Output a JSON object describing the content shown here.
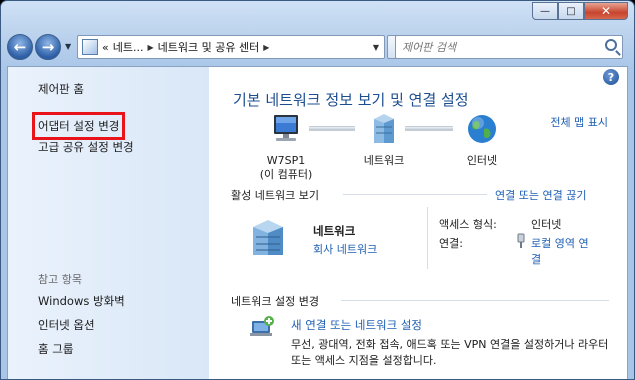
{
  "window": {
    "controls": {
      "minimize": "—",
      "maximize": "□",
      "close": "✕"
    }
  },
  "navbar": {
    "back_icon": "←",
    "forward_icon": "→",
    "history_dropdown": "▼",
    "address": {
      "overflow": "«",
      "segment1": "네트...",
      "separator": "▶",
      "segment2": "네트워크 및 공유 센터",
      "separator2": "▶",
      "dropdown": "▼"
    },
    "refresh_icon": "↻",
    "search_placeholder": "제어판 검색"
  },
  "sidebar": {
    "home": "제어판 홈",
    "change_adapter": "어댑터 설정 변경",
    "advanced_sharing": "고급 공유 설정 변경",
    "see_also_heading": "참고 항목",
    "firewall": "Windows 방화벽",
    "internet_options": "인터넷 옵션",
    "homegroup": "홈 그룹"
  },
  "main": {
    "help_icon": "?",
    "title": "기본 네트워크 정보 보기 및 연결 설정",
    "full_map": "전체 맵 표시",
    "map": {
      "computer_name": "W7SP1",
      "computer_sub": "(이 컴퓨터)",
      "network": "네트워크",
      "internet": "인터넷"
    },
    "active_section": {
      "title": "활성 네트워크 보기",
      "connect_link": "연결 또는 연결 끊기",
      "network_name": "네트워크",
      "network_type": "회사 네트워크",
      "access_type_label": "액세스 형식:",
      "access_type_value": "인터넷",
      "connections_label": "연결:",
      "connections_value_line1": "로컬 영역 연",
      "connections_value_line2": "결"
    },
    "change_section": {
      "title": "네트워크 설정 변경",
      "new_connection_link": "새 연결 또는 네트워크 설정",
      "new_connection_desc": "무선, 광대역, 전화 접속, 애드혹 또는 VPN 연결을 설정하거나 라우터 또는 액세스 지점을 설정합니다."
    }
  },
  "colors": {
    "link": "#1f5fb4",
    "title": "#1d4e90",
    "highlight_box": "#e8141a"
  }
}
